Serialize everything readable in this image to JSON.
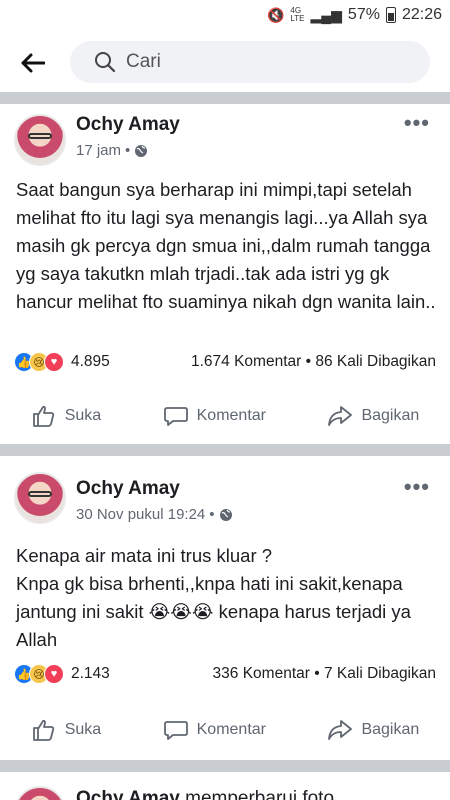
{
  "status_bar": {
    "mute_icon": "mute-icon",
    "network": "4G",
    "network_sub": "LTE",
    "battery": "57%",
    "time": "22:26"
  },
  "search": {
    "placeholder": "Cari"
  },
  "posts": [
    {
      "author": "Ochy Amay",
      "time": "17 jam",
      "body": "Saat bangun sya berharap ini mimpi,tapi setelah melihat fto itu lagi sya menangis lagi...ya Allah sya masih gk percya dgn smua ini,,dalm rumah tangga yg saya takutkn mlah trjadi..tak ada istri yg gk hancur melihat fto suaminya nikah dgn wanita lain..",
      "reaction_count": "4.895",
      "comments": "1.674 Komentar",
      "shares": "86 Kali Dibagikan"
    },
    {
      "author": "Ochy Amay",
      "time": "30 Nov pukul 19:24",
      "body": "Kenapa air mata ini trus kluar ?\nKnpa gk bisa brhenti,,knpa hati ini sakit,kenapa jantung ini sakit 😭😭😭 kenapa harus terjadi ya Allah",
      "reaction_count": "2.143",
      "comments": "336 Komentar",
      "shares": "7 Kali Dibagikan"
    },
    {
      "author": "Ochy Amay",
      "action_text": "memperbarui foto"
    }
  ],
  "actions": {
    "like": "Suka",
    "comment": "Komentar",
    "share": "Bagikan"
  },
  "separator": "•",
  "more": "•••"
}
